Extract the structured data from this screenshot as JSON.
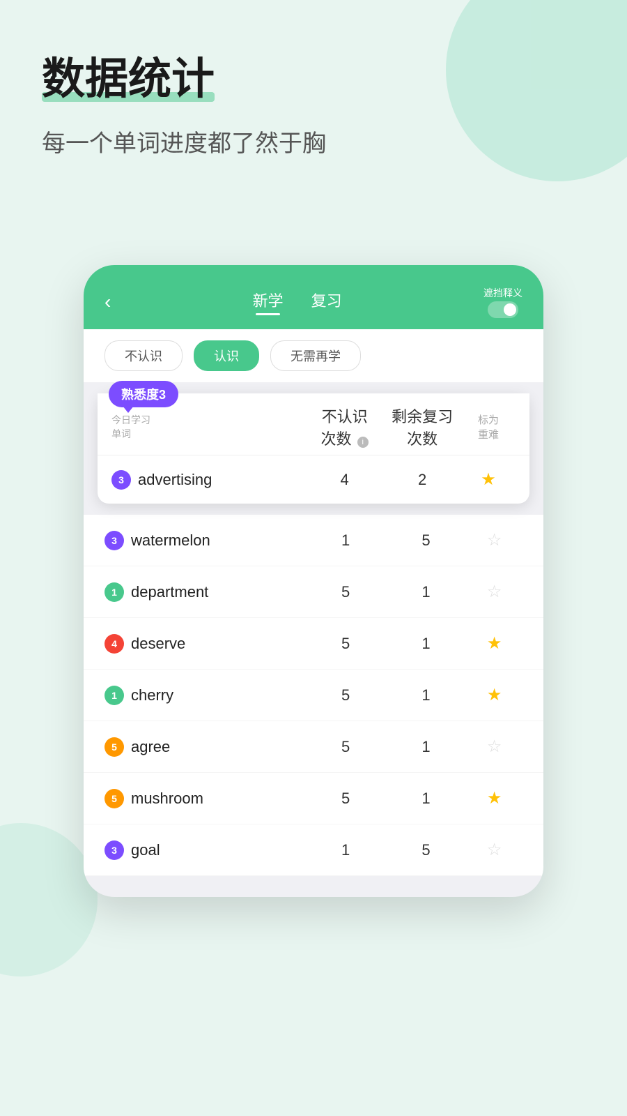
{
  "page": {
    "title": "数据统计",
    "subtitle": "每一个单词进度都了然于胸"
  },
  "phone": {
    "nav": {
      "back": "‹",
      "tab_new": "新学",
      "tab_review": "复习",
      "hide_label": "遮挡释义"
    },
    "filters": [
      {
        "label": "不认识",
        "active": false
      },
      {
        "label": "认识",
        "active": true
      },
      {
        "label": "无需再学",
        "active": false
      }
    ],
    "table_headers": {
      "col1": "今日学习\n单词",
      "col1_line1": "今日学习",
      "col1_line2": "单词",
      "col2_line1": "不认识",
      "col2_line2": "次数",
      "col3_line1": "剩余复习",
      "col3_line2": "次数",
      "col4": "标为\n重难",
      "col4_line1": "标为",
      "col4_line2": "重难"
    },
    "highlighted_word": {
      "familiarity": "熟悉度3",
      "badge_num": "3",
      "badge_color": "purple",
      "word": "advertising",
      "stat1": "4",
      "stat2": "2",
      "starred": true
    },
    "words": [
      {
        "badge_num": "3",
        "badge_color": "purple",
        "word": "watermelon",
        "stat1": "1",
        "stat2": "5",
        "starred": false
      },
      {
        "badge_num": "1",
        "badge_color": "green",
        "word": "department",
        "stat1": "5",
        "stat2": "1",
        "starred": false
      },
      {
        "badge_num": "4",
        "badge_color": "red",
        "word": "deserve",
        "stat1": "5",
        "stat2": "1",
        "starred": true
      },
      {
        "badge_num": "1",
        "badge_color": "green",
        "word": "cherry",
        "stat1": "5",
        "stat2": "1",
        "starred": true
      },
      {
        "badge_num": "5",
        "badge_color": "orange",
        "word": "agree",
        "stat1": "5",
        "stat2": "1",
        "starred": false
      },
      {
        "badge_num": "5",
        "badge_color": "orange",
        "word": "mushroom",
        "stat1": "5",
        "stat2": "1",
        "starred": true
      },
      {
        "badge_num": "3",
        "badge_color": "purple",
        "word": "goal",
        "stat1": "1",
        "stat2": "5",
        "starred": false
      }
    ]
  }
}
